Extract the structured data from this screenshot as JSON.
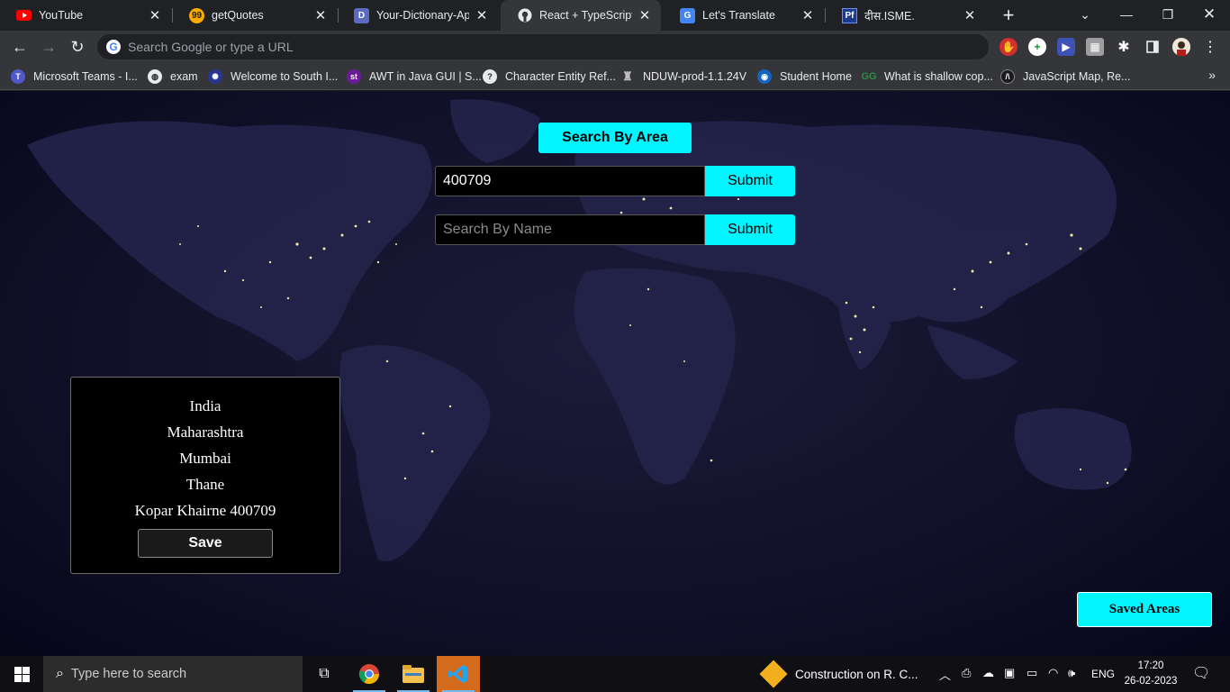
{
  "browser": {
    "tabs": [
      {
        "title": "YouTube",
        "icon": "youtube-icon",
        "active": false
      },
      {
        "title": "getQuotes",
        "icon": "quotes-icon",
        "active": false
      },
      {
        "title": "Your-Dictionary-App",
        "icon": "dictionary-icon",
        "active": false
      },
      {
        "title": "React + TypeScript + I",
        "icon": "github-icon",
        "active": true
      },
      {
        "title": "Let's Translate",
        "icon": "translate-icon",
        "active": false
      },
      {
        "title": "दीस.ISME.",
        "icon": "pf-icon",
        "active": false
      }
    ],
    "omnibox_placeholder": "Search Google or type a URL",
    "bookmarks": [
      {
        "label": "Microsoft Teams - I...",
        "icon": "teams-icon"
      },
      {
        "label": "exam",
        "icon": "globe-icon"
      },
      {
        "label": "Welcome to South I...",
        "icon": "south-indian-bank-icon"
      },
      {
        "label": "AWT in Java GUI | S...",
        "icon": "st-icon"
      },
      {
        "label": "Character Entity Ref...",
        "icon": "question-icon"
      },
      {
        "label": "NDUW-prod-1.1.24V",
        "icon": "emblem-icon"
      },
      {
        "label": "Student Home",
        "icon": "student-icon"
      },
      {
        "label": "What is shallow cop...",
        "icon": "gfg-icon"
      },
      {
        "label": "JavaScript Map, Re...",
        "icon": "code-icon"
      }
    ]
  },
  "page": {
    "search_by_area_label": "Search By Area",
    "pincode_value": "400709",
    "submit_label_1": "Submit",
    "name_placeholder": "Search By Name",
    "submit_label_2": "Submit",
    "result": {
      "country": "India",
      "state": "Maharashtra",
      "district": "Mumbai",
      "division": "Thane",
      "office": "Kopar Khairne 400709"
    },
    "save_label": "Save",
    "saved_areas_label": "Saved Areas"
  },
  "taskbar": {
    "search_placeholder": "Type here to search",
    "weather_text": "Construction on R. C...",
    "language": "ENG",
    "time": "17:20",
    "date": "26-02-2023"
  },
  "colors": {
    "accent": "#00f5ff",
    "card_bg": "#000000",
    "chrome_bg": "#35363a"
  }
}
